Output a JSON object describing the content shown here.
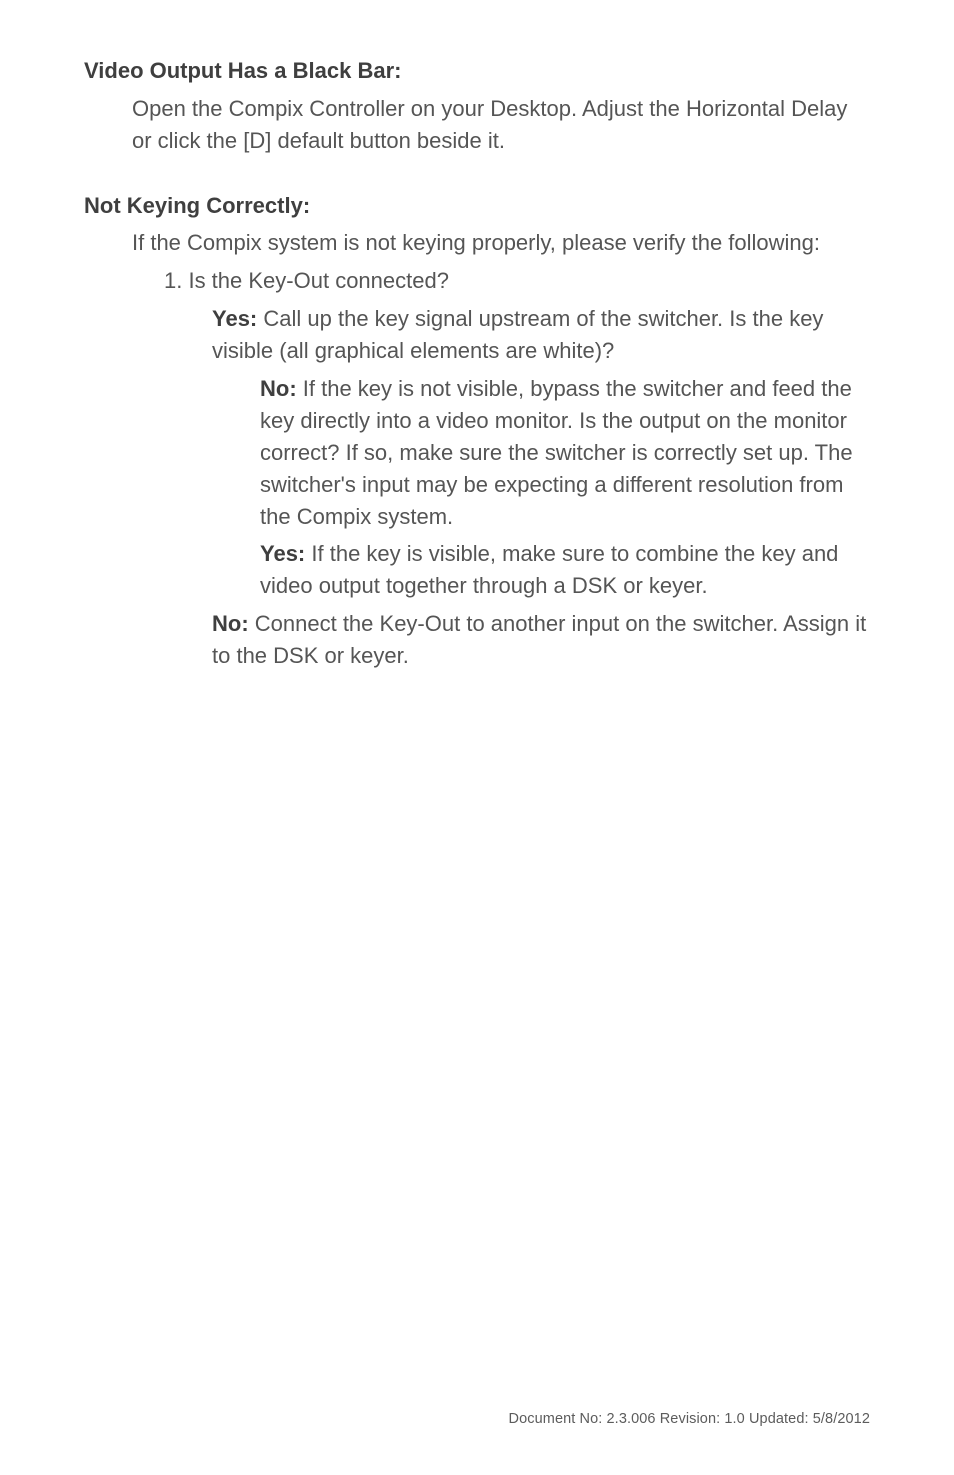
{
  "sections": {
    "video_output": {
      "heading": "Video Output Has a Black Bar:",
      "body": "Open the Compix Controller on your Desktop. Adjust the Horizontal Delay or click the [D] default button beside it."
    },
    "not_keying": {
      "heading": "Not Keying Correctly:",
      "intro": "If the Compix system is not keying properly, please verify the following:",
      "step1": "1. Is the Key-Out connected?",
      "yes_label": "Yes:",
      "yes_text": " Call up the key signal upstream of the switcher. Is the key visible (all graphical elements are white)?",
      "sub_no_label": "No:",
      "sub_no_text": " If the key is not visible, bypass the switcher and feed the key directly into a video monitor. Is the output on the monitor correct? If so, make sure the switcher is correctly set up. The switcher's input may be expecting a different resolution from the Compix system.",
      "sub_yes_label": "Yes:",
      "sub_yes_text": " If the key is visible, make sure to combine the key and video output together through a DSK or keyer.",
      "no_label": "No:",
      "no_text": " Connect the Key-Out to another input on the switcher. Assign it to the DSK or keyer."
    }
  },
  "footer": "Document No: 2.3.006   Revision: 1.0   Updated: 5/8/2012"
}
